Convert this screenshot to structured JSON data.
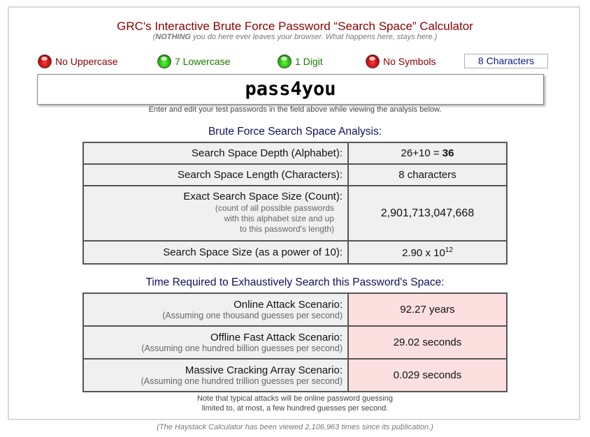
{
  "header": {
    "title": "GRC's Interactive Brute Force Password “Search Space” Calculator",
    "subtitle_pre": "(",
    "subtitle_bold": "NOTHING",
    "subtitle_post": " you do here ever leaves your browser. What happens here, stays here.)"
  },
  "indicators": [
    {
      "label": "No Uppercase",
      "state": "off",
      "color": "#cc0000"
    },
    {
      "label": "7 Lowercase",
      "state": "on",
      "color": "#2db300"
    },
    {
      "label": "1 Digit",
      "state": "on",
      "color": "#2db300"
    },
    {
      "label": "No Symbols",
      "state": "off",
      "color": "#cc0000"
    }
  ],
  "char_count": "8 Characters",
  "password": {
    "value": "pass4you"
  },
  "hint": "Enter and edit your test passwords in the field above while viewing the analysis below.",
  "analysis": {
    "heading": "Brute Force Search Space Analysis:",
    "depth_label": "Search Space Depth (Alphabet):",
    "depth_expr": "26+10 = ",
    "depth_total": "36",
    "length_label": "Search Space Length (Characters):",
    "length_value": "8 characters",
    "exact_label": "Exact Search Space Size (Count):",
    "exact_note_1": "(count of all possible passwords",
    "exact_note_2": "with this alphabet size and up",
    "exact_note_3": "to this password's length)",
    "exact_value": "2,901,713,047,668",
    "power_label": "Search Space Size (as a power of 10):",
    "power_mantissa": "2.90 x 10",
    "power_exponent": "12"
  },
  "time": {
    "heading": "Time Required to Exhaustively Search this Password's Space:",
    "online_label": "Online Attack Scenario:",
    "online_note": "(Assuming one thousand guesses per second)",
    "online_value": "92.27 years",
    "offline_label": "Offline Fast Attack Scenario:",
    "offline_note": "(Assuming one hundred billion guesses per second)",
    "offline_value": "29.02 seconds",
    "massive_label": "Massive Cracking Array Scenario:",
    "massive_note": "(Assuming one hundred trillion guesses per second)",
    "massive_value": "0.029 seconds"
  },
  "note_1": "Note that typical attacks will be online password guessing",
  "note_2": "limited to, at most, a few hundred guesses per second.",
  "footer": "(The Haystack Calculator has been viewed 2,106,963 times since its publication.)"
}
